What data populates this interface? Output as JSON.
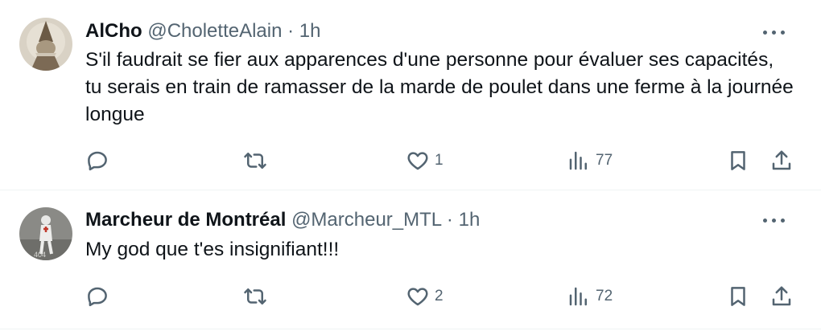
{
  "tweets": [
    {
      "display_name": "AlCho",
      "handle": "@CholetteAlain",
      "separator": "·",
      "time": "1h",
      "text": "S'il faudrait se fier aux apparences d'une personne pour évaluer ses capacités, tu serais en train de ramasser de la marde de poulet dans une ferme à la journée longue",
      "reply_count": "",
      "retweet_count": "",
      "like_count": "1",
      "view_count": "77"
    },
    {
      "display_name": "Marcheur de Montréal",
      "handle": "@Marcheur_MTL",
      "separator": "·",
      "time": "1h",
      "text": "My god que t'es insignifiant!!!",
      "reply_count": "",
      "retweet_count": "",
      "like_count": "2",
      "view_count": "72"
    }
  ],
  "icons": {
    "reply": "reply-icon",
    "retweet": "retweet-icon",
    "like": "heart-icon",
    "views": "views-icon",
    "bookmark": "bookmark-icon",
    "share": "share-icon",
    "more": "more-icon"
  },
  "colors": {
    "text": "#0f1419",
    "secondary": "#536471",
    "divider": "#eff3f4"
  }
}
